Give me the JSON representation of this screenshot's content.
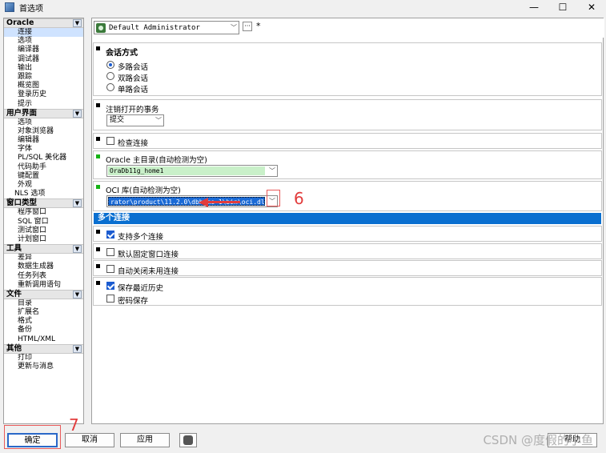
{
  "window": {
    "title": "首选项",
    "minimize": "—",
    "maximize": "☐",
    "close": "✕"
  },
  "left_tree": {
    "groups": [
      {
        "label": "Oracle",
        "items": [
          "连接",
          "选项",
          "编译器",
          "调试器",
          "输出",
          "跟踪",
          "概览图",
          "登录历史",
          "提示"
        ]
      },
      {
        "label": "用户界面",
        "items": [
          "选项",
          "对象浏览器",
          "编辑器",
          "字体",
          "PL/SQL 美化器",
          "代码助手",
          "键配置",
          "外观",
          "NLS 选项"
        ]
      },
      {
        "label": "窗口类型",
        "items": [
          "程序窗口",
          "SQL 窗口",
          "测试窗口",
          "计划窗口"
        ]
      },
      {
        "label": "工具",
        "items": [
          "差异",
          "数据生成器",
          "任务列表",
          "重新调用语句"
        ]
      },
      {
        "label": "文件",
        "items": [
          "目录",
          "扩展名",
          "格式",
          "备份",
          "HTML/XML"
        ]
      },
      {
        "label": "其他",
        "items": [
          "打印",
          "更新与消息"
        ]
      }
    ],
    "selected": "连接"
  },
  "topbar": {
    "profile": "Default Administrator",
    "more_label": "···",
    "star_label": "*"
  },
  "session": {
    "title": "会话方式",
    "options": [
      "多路会话",
      "双路会话",
      "单路会话"
    ],
    "selected_index": 0
  },
  "logoff": {
    "label": "注销打开的事务",
    "value": "提交"
  },
  "check_connection": {
    "label": "检查连接",
    "checked": false
  },
  "oracle_home": {
    "label": "Oracle 主目录(自动检测为空)",
    "value": "OraDb11g_home1"
  },
  "oci": {
    "label": "OCI 库(自动检测为空)",
    "value": "rator\\product\\11.2.0\\dbhome_1\\bin\\oci.dll"
  },
  "multi": {
    "header": "多个连接",
    "support_multiple": {
      "label": "支持多个连接",
      "checked": true
    },
    "default_fixed": {
      "label": "默认固定窗口连接",
      "checked": false
    },
    "auto_close": {
      "label": "自动关闭未用连接",
      "checked": false
    },
    "save_history": {
      "label": "保存最近历史",
      "checked": true
    },
    "save_password": {
      "label": "密码保存",
      "checked": false
    }
  },
  "buttons": {
    "ok": "确定",
    "cancel": "取消",
    "apply": "应用",
    "help": "帮助"
  },
  "annotations": {
    "six": "6",
    "seven": "7",
    "color": "#e23c3c"
  },
  "watermark": "CSDN @度假的小鱼"
}
